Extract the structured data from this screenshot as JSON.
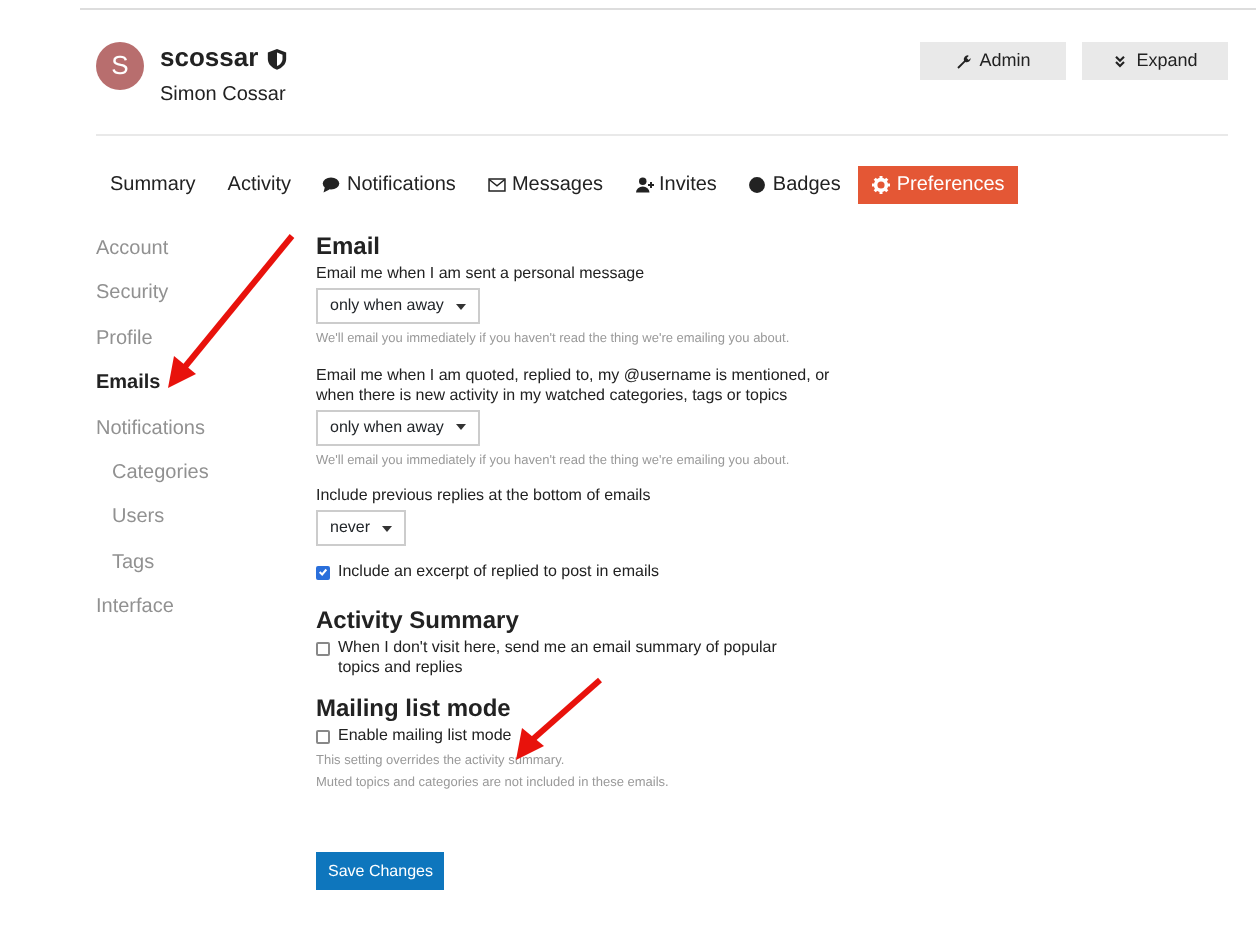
{
  "user": {
    "initial": "S",
    "username": "scossar",
    "full_name": "Simon Cossar"
  },
  "header_buttons": [
    {
      "label": "Admin"
    },
    {
      "label": "Expand"
    }
  ],
  "tabs": [
    {
      "label": "Summary",
      "selected": false
    },
    {
      "label": "Activity",
      "selected": false
    },
    {
      "label": "Notifications",
      "selected": false
    },
    {
      "label": "Messages",
      "selected": false
    },
    {
      "label": "Invites",
      "selected": false
    },
    {
      "label": "Badges",
      "selected": false
    },
    {
      "label": "Preferences",
      "selected": true
    }
  ],
  "sidebar": {
    "items": [
      {
        "label": "Account",
        "selected": false
      },
      {
        "label": "Security",
        "selected": false
      },
      {
        "label": "Profile",
        "selected": false
      },
      {
        "label": "Emails",
        "selected": true
      },
      {
        "label": "Notifications",
        "selected": false,
        "children": [
          {
            "label": "Categories",
            "selected": false
          },
          {
            "label": "Users",
            "selected": false
          },
          {
            "label": "Tags",
            "selected": false
          }
        ]
      },
      {
        "label": "Interface",
        "selected": false
      }
    ]
  },
  "sections": [
    {
      "title": "Email",
      "items": [
        {
          "kind": "select",
          "label": "Email me when I am sent a personal message",
          "value": "only when away",
          "hint": "We'll email you immediately if you haven't read the thing we're emailing you about."
        },
        {
          "kind": "select",
          "label": "Email me when I am quoted, replied to, my @username is mentioned, or when there is new activity in my watched categories, tags or topics",
          "value": "only when away",
          "hint": "We'll email you immediately if you haven't read the thing we're emailing you about."
        },
        {
          "kind": "select",
          "label": "Include previous replies at the bottom of emails",
          "value": "never"
        },
        {
          "kind": "checkbox",
          "label": "Include an excerpt of replied to post in emails",
          "checked": true
        }
      ]
    },
    {
      "title": "Activity Summary",
      "items": [
        {
          "kind": "checkbox",
          "label": "When I don't visit here, send me an email summary of popular topics and replies",
          "checked": false
        }
      ]
    },
    {
      "title": "Mailing list mode",
      "items": [
        {
          "kind": "checkbox",
          "label": "Enable mailing list mode",
          "checked": false,
          "hint_lines": [
            "This setting overrides the activity summary.",
            "Muted topics and categories are not included in these emails."
          ]
        }
      ]
    }
  ],
  "save_button": "Save Changes"
}
